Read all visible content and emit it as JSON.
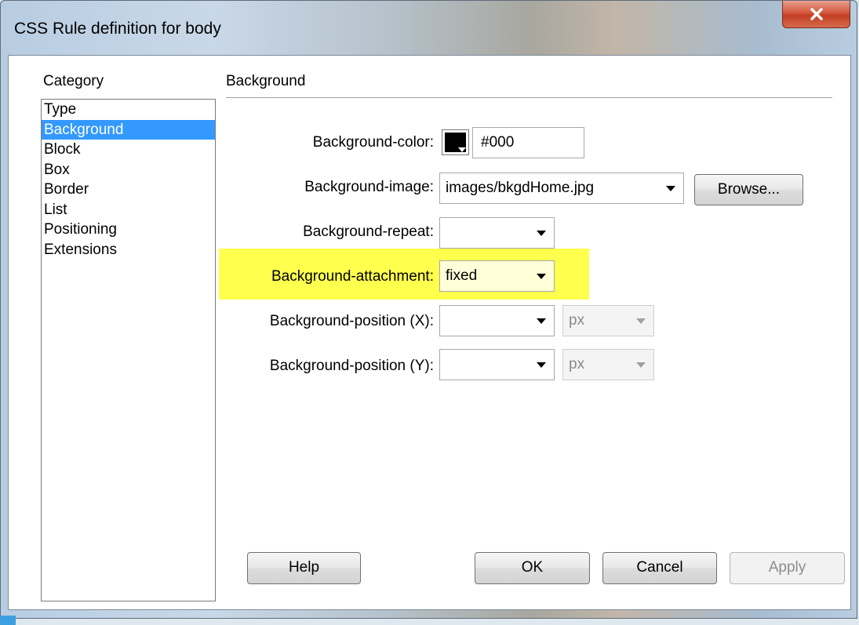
{
  "window": {
    "title": "CSS Rule definition for body",
    "close_symbol": "X"
  },
  "category": {
    "label": "Category",
    "items": [
      "Type",
      "Background",
      "Block",
      "Box",
      "Border",
      "List",
      "Positioning",
      "Extensions"
    ],
    "selected": "Background"
  },
  "section_title": "Background",
  "fields": {
    "bg_color": {
      "label": "Background-color:",
      "swatch_color": "#000000",
      "value": "#000"
    },
    "bg_image": {
      "label": "Background-image:",
      "value": "images/bkgdHome.jpg",
      "browse": "Browse..."
    },
    "bg_repeat": {
      "label": "Background-repeat:",
      "value": ""
    },
    "bg_attachment": {
      "label": "Background-attachment:",
      "value": "fixed",
      "highlight_color": "#ffff4d"
    },
    "bg_pos_x": {
      "label": "Background-position (X):",
      "value": "",
      "unit": "px"
    },
    "bg_pos_y": {
      "label": "Background-position (Y):",
      "value": "",
      "unit": "px"
    }
  },
  "buttons": {
    "help": "Help",
    "ok": "OK",
    "cancel": "Cancel",
    "apply": "Apply"
  }
}
